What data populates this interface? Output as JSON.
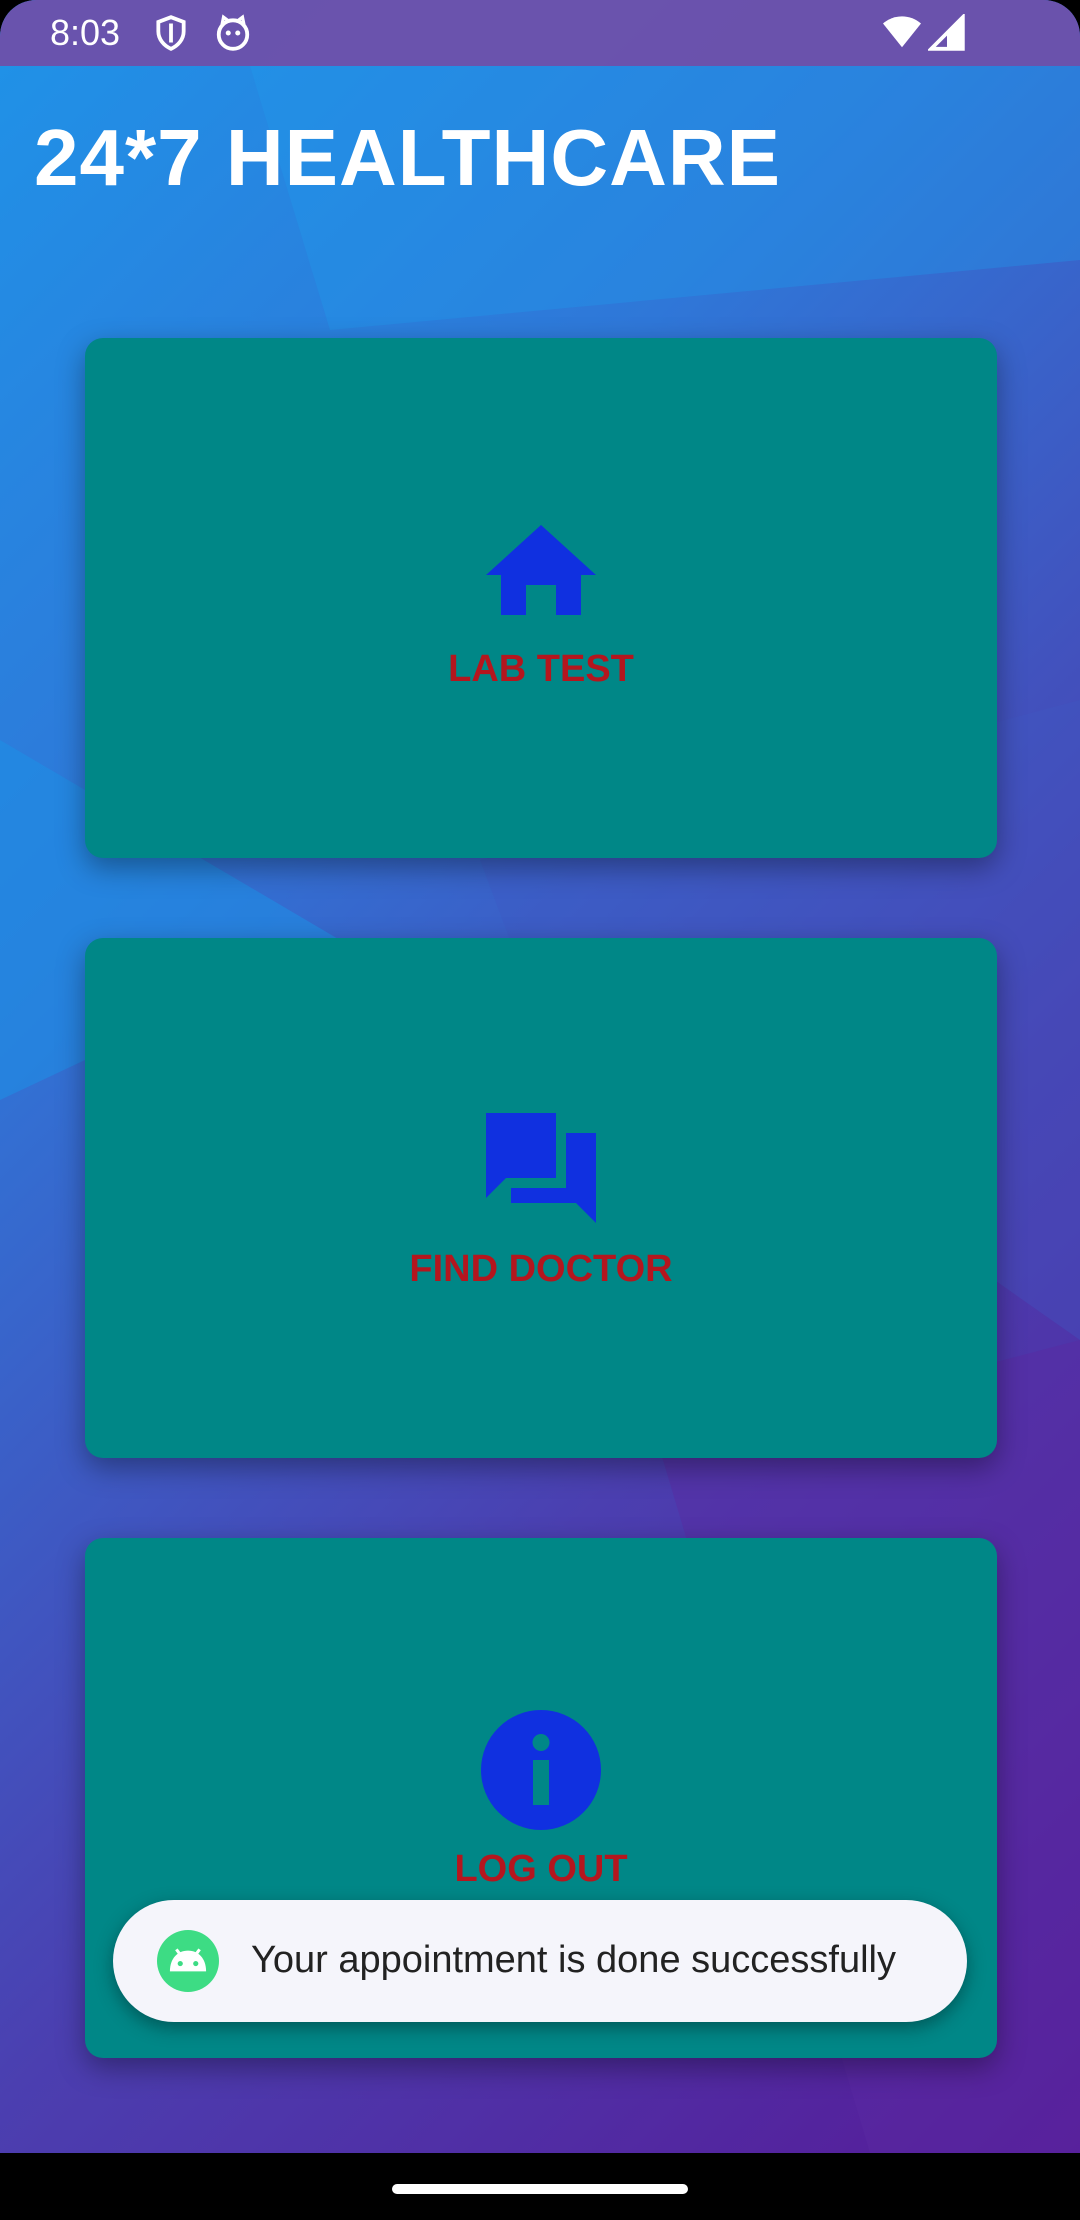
{
  "status_bar": {
    "time": "8:03",
    "icons": [
      "shield-icon",
      "cat-icon",
      "wifi-icon",
      "cellular-signal-icon"
    ]
  },
  "app": {
    "title": "24*7 HEALTHCARE"
  },
  "cards": [
    {
      "label": "LAB TEST",
      "icon": "home-icon"
    },
    {
      "label": "FIND DOCTOR",
      "icon": "chat-icon"
    },
    {
      "label": "LOG OUT",
      "icon": "info-icon"
    }
  ],
  "toast": {
    "message": "Your appointment is done successfully",
    "icon": "android-icon"
  },
  "colors": {
    "card": "#008787",
    "card_label": "#b4161e",
    "card_icon": "#1030e0",
    "gradient_start": "#1f93e8",
    "gradient_end": "#561b98"
  }
}
